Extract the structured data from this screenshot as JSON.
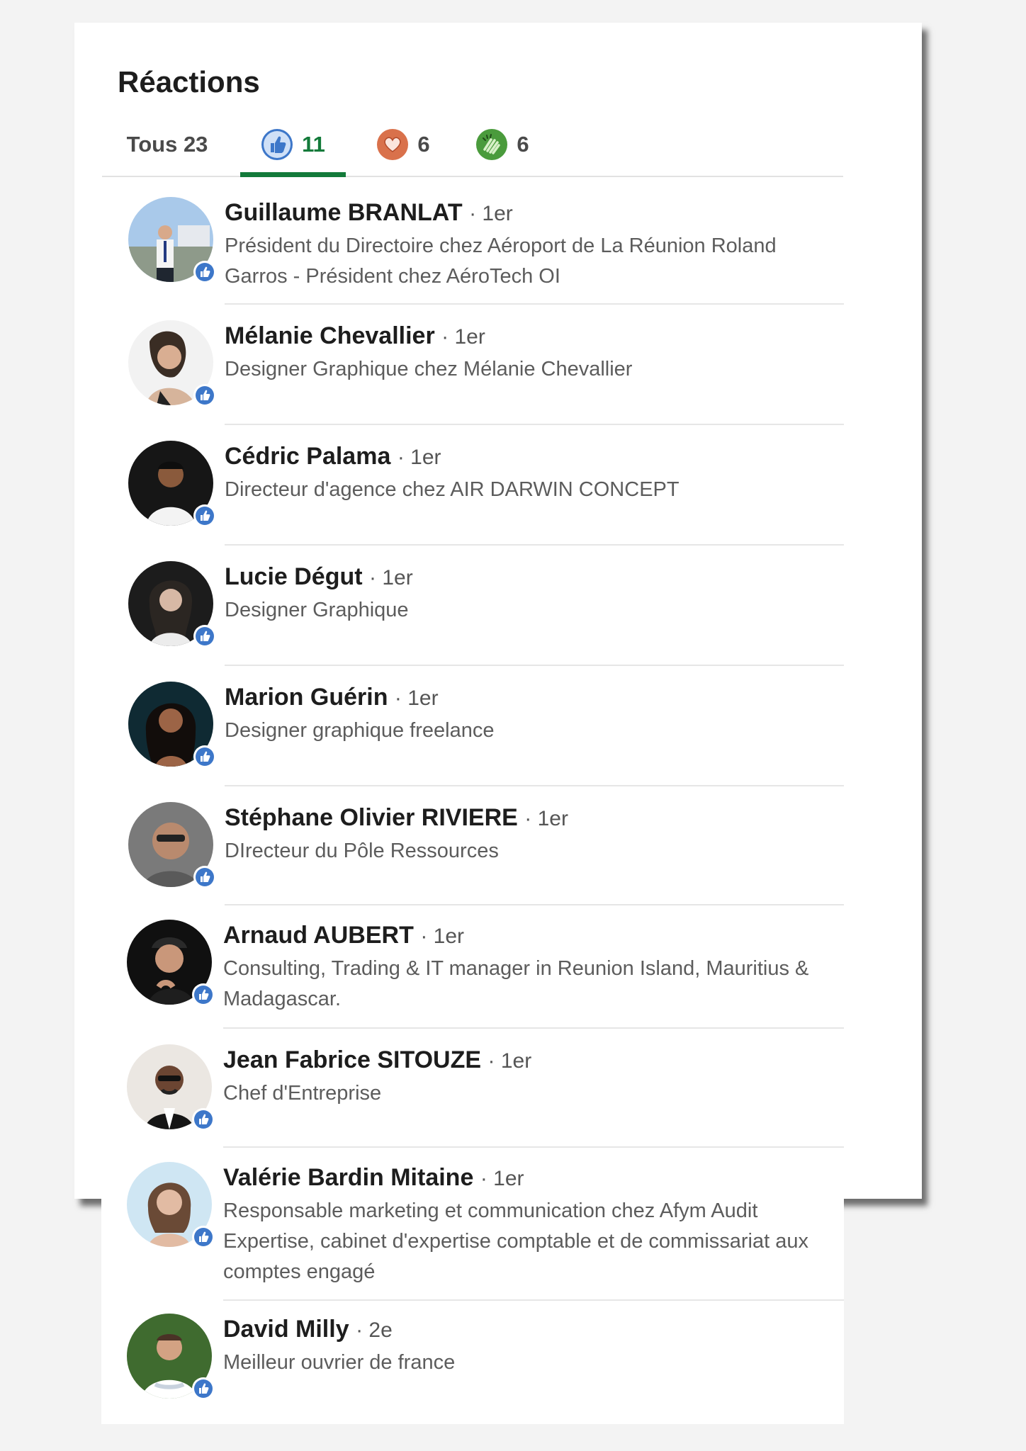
{
  "title": "Réactions",
  "tabs": [
    {
      "label": "Tous 23",
      "count": "",
      "icon": "none"
    },
    {
      "label": "",
      "count": "11",
      "icon": "like-icon"
    },
    {
      "label": "",
      "count": "6",
      "icon": "heart-icon"
    },
    {
      "label": "",
      "count": "6",
      "icon": "clap-icon"
    }
  ],
  "colors": {
    "accent": "#137a3a",
    "like_blue": "#3d77c9",
    "heart": "#d9714b",
    "clap": "#4a9b3c"
  },
  "people": [
    {
      "name": "Guillaume BRANLAT",
      "degree": "· 1er",
      "headline": "Président du Directoire chez Aéroport de La Réunion Roland Garros - Président chez AéroTech OI"
    },
    {
      "name": "Mélanie Chevallier",
      "degree": "· 1er",
      "headline": "Designer Graphique chez Mélanie Chevallier"
    },
    {
      "name": "Cédric Palama",
      "degree": "· 1er",
      "headline": "Directeur d'agence chez AIR DARWIN CONCEPT"
    },
    {
      "name": "Lucie Dégut",
      "degree": "· 1er",
      "headline": "Designer Graphique"
    },
    {
      "name": "Marion Guérin",
      "degree": "· 1er",
      "headline": "Designer graphique freelance"
    },
    {
      "name": "Stéphane Olivier RIVIERE",
      "degree": "· 1er",
      "headline": "DIrecteur du Pôle Ressources"
    },
    {
      "name": "Arnaud AUBERT",
      "degree": "· 1er",
      "headline": "Consulting, Trading & IT manager in Reunion Island, Mauritius & Madagascar."
    },
    {
      "name": "Jean Fabrice SITOUZE",
      "degree": "· 1er",
      "headline": "Chef d'Entreprise"
    },
    {
      "name": "Valérie Bardin Mitaine",
      "degree": "· 1er",
      "headline": "Responsable marketing et communication chez Afym Audit Expertise, cabinet d'expertise comptable et de commissariat aux comptes engagé"
    },
    {
      "name": "David Milly",
      "degree": "· 2e",
      "headline": "Meilleur ouvrier de france"
    }
  ]
}
